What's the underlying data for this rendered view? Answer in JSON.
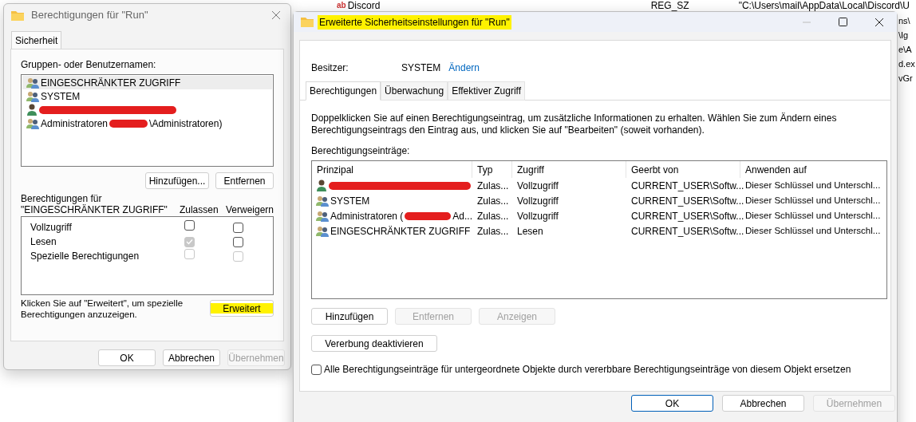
{
  "background_window": {
    "top_row": {
      "value_icon": "ab",
      "name": "Discord",
      "type": "REG_SZ",
      "data": "\"C:\\Users\\mail\\AppData\\Local\\Discord\\U"
    },
    "edge_fragments": [
      "ns\\",
      "\\Ig",
      "e\\A",
      "d.ex",
      "vGr"
    ]
  },
  "properties_dialog": {
    "title": "Berechtigungen für \"Run\"",
    "tabs": [
      {
        "label": "Sicherheit",
        "selected": true
      }
    ],
    "names_label": "Gruppen- oder Benutzernamen:",
    "names": [
      {
        "kind": "group",
        "selected": true,
        "parts": [
          {
            "kind": "text",
            "text": "EINGESCHRÄNKTER ZUGRIFF"
          }
        ]
      },
      {
        "kind": "group",
        "selected": false,
        "parts": [
          {
            "kind": "text",
            "text": "SYSTEM"
          }
        ]
      },
      {
        "kind": "user",
        "selected": false,
        "parts": [
          {
            "kind": "redaction"
          }
        ]
      },
      {
        "kind": "group",
        "selected": false,
        "parts": [
          {
            "kind": "text",
            "text": "Administratoren"
          },
          {
            "kind": "redaction"
          },
          {
            "kind": "text",
            "text": "\\Administratoren)"
          }
        ]
      }
    ],
    "list_buttons": [
      {
        "label": "Hinzufügen...",
        "disabled": false
      },
      {
        "label": "Entfernen",
        "disabled": false
      }
    ],
    "permissions_for": "Berechtigungen für",
    "permissions_principal": "\"EINGESCHRÄNKTER ZUGRIFF\"",
    "columns": [
      "Zulassen",
      "Verweigern"
    ],
    "permissions": [
      {
        "name": "Vollzugriff",
        "allow": {
          "checked": false,
          "disabled": false
        },
        "deny": {
          "checked": false,
          "disabled": false
        }
      },
      {
        "name": "Lesen",
        "allow": {
          "checked": true,
          "disabled": true
        },
        "deny": {
          "checked": false,
          "disabled": false
        }
      },
      {
        "name": "Spezielle Berechtigungen",
        "allow": {
          "checked": false,
          "disabled": true
        },
        "deny": {
          "checked": false,
          "disabled": true
        }
      }
    ],
    "advanced_hint": "Klicken Sie auf \"Erweitert\", um spezielle Berechtigungen anzuzeigen.",
    "advanced_button": {
      "label": "Erweitert",
      "highlighted": true
    },
    "buttons": [
      {
        "label": "OK",
        "disabled": false
      },
      {
        "label": "Abbrechen",
        "disabled": false
      },
      {
        "label": "Übernehmen",
        "disabled": true
      }
    ]
  },
  "advanced_dialog": {
    "title": "Erweiterte Sicherheitseinstellungen für \"Run\"",
    "title_highlighted": true,
    "owner_label": "Besitzer:",
    "owner": "SYSTEM",
    "change_link": "Ändern",
    "tabs": [
      {
        "label": "Berechtigungen",
        "selected": true
      },
      {
        "label": "Überwachung",
        "selected": false
      },
      {
        "label": "Effektiver Zugriff",
        "selected": false
      }
    ],
    "description": "Doppelklicken Sie auf einen Berechtigungseintrag, um zusätzliche Informationen zu erhalten. Wählen Sie zum Ändern eines Berechtigungseintrags den Eintrag aus, und klicken Sie auf \"Bearbeiten\" (soweit vorhanden).",
    "entries_label": "Berechtigungseinträge:",
    "table": {
      "columns": [
        "Prinzipal",
        "Typ",
        "Zugriff",
        "Geerbt von",
        "Anwenden auf"
      ],
      "rows": [
        {
          "kind": "user",
          "principal": [
            {
              "kind": "redaction"
            }
          ],
          "type": "Zulas...",
          "access": "Vollzugriff",
          "inherited": "CURRENT_USER\\Softw...",
          "applies": "Dieser Schlüssel und Unterschl..."
        },
        {
          "kind": "group",
          "principal": [
            {
              "kind": "text",
              "text": "SYSTEM"
            }
          ],
          "type": "Zulas...",
          "access": "Vollzugriff",
          "inherited": "CURRENT_USER\\Softw...",
          "applies": "Dieser Schlüssel und Unterschl..."
        },
        {
          "kind": "group",
          "principal": [
            {
              "kind": "text",
              "text": "Administratoren ("
            },
            {
              "kind": "redaction"
            },
            {
              "kind": "text",
              "text": "Ad..."
            }
          ],
          "type": "Zulas...",
          "access": "Vollzugriff",
          "inherited": "CURRENT_USER\\Softw...",
          "applies": "Dieser Schlüssel und Unterschl..."
        },
        {
          "kind": "group",
          "principal": [
            {
              "kind": "text",
              "text": "EINGESCHRÄNKTER ZUGRIFF"
            }
          ],
          "type": "Zulas...",
          "access": "Lesen",
          "inherited": "CURRENT_USER\\Softw...",
          "applies": "Dieser Schlüssel und Unterschl..."
        }
      ]
    },
    "entry_buttons": [
      {
        "label": "Hinzufügen",
        "disabled": false
      },
      {
        "label": "Entfernen",
        "disabled": true
      },
      {
        "label": "Anzeigen",
        "disabled": true
      }
    ],
    "inheritance_button": "Vererbung deaktivieren",
    "replace_checkbox": {
      "label": "Alle Berechtigungseinträge für untergeordnete Objekte durch vererbbare Berechtigungseinträge von diesem Objekt ersetzen",
      "checked": false
    },
    "buttons": [
      {
        "label": "OK",
        "disabled": false,
        "default": true
      },
      {
        "label": "Abbrechen",
        "disabled": false,
        "default": false
      },
      {
        "label": "Übernehmen",
        "disabled": true,
        "default": false
      }
    ]
  }
}
